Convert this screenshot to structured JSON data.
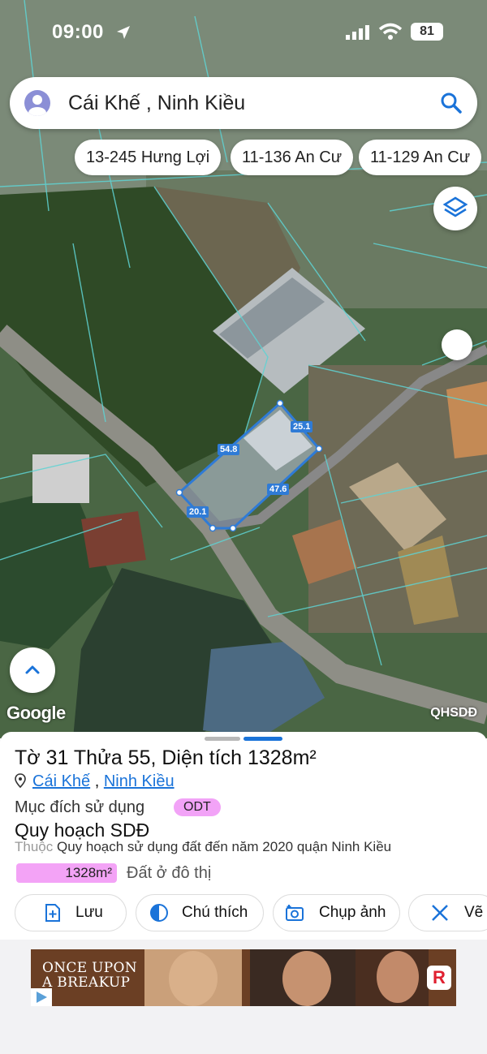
{
  "status_bar": {
    "time": "09:00",
    "battery": "81"
  },
  "search": {
    "query": "Cái Khế , Ninh Kiều"
  },
  "chips": [
    "13-245 Hưng Lợi",
    "11-136 An Cư",
    "11-129 An Cư"
  ],
  "parcel": {
    "edges": [
      "54.8",
      "25.1",
      "47.6",
      "20.1"
    ]
  },
  "map": {
    "attribution": "Google",
    "layer_label": "QHSDĐ"
  },
  "sheet": {
    "title": "Tờ 31 Thửa 55, Diện tích 1328m²",
    "ward": "Cái Khế",
    "separator": ",",
    "district": "Ninh Kiều",
    "purpose_label": "Mục đích sử dụng",
    "purpose_code": "ODT",
    "plan_title": "Quy hoạch SDĐ",
    "plan_belong_prefix": "Thuộc",
    "plan_belong_name": "Quy hoạch sử dụng đất đến năm 2020 quận Ninh Kiều",
    "area_value": "1328m²",
    "area_type": "Đất ở đô thị",
    "actions": [
      {
        "label": "Lưu",
        "icon": "add-file-icon"
      },
      {
        "label": "Chú thích",
        "icon": "contrast-circle-icon"
      },
      {
        "label": "Chụp ảnh",
        "icon": "camera-icon"
      },
      {
        "label": "Vẽ",
        "icon": "draw-ruler-icon"
      }
    ]
  },
  "ad": {
    "title_line1": "ONCE UPON",
    "title_line2": "A BREAKUP",
    "badge": "R"
  },
  "colors": {
    "accent": "#1a73d9",
    "parcel": "#2f7bd6",
    "plan_pink": "#f3a3f6",
    "map_lines": "#5fd3d3"
  }
}
